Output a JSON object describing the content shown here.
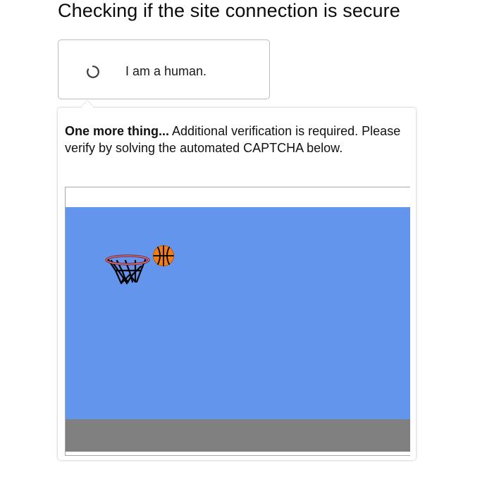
{
  "page": {
    "title": "Checking if the site connection is secure"
  },
  "human_check": {
    "label": "I am a human.",
    "spinner_icon": "loading-spinner-icon"
  },
  "verification": {
    "lead": "One more thing...",
    "message": " Additional verification is required. Please verify by solving the automated CAPTCHA below."
  },
  "captcha": {
    "icons": {
      "hoop": "basketball-hoop-icon",
      "ball": "basketball-icon"
    },
    "colors": {
      "sky": "#6495ed",
      "ground": "#808080",
      "ball": "#f07d1b",
      "rim": "#8b1a2b",
      "net": "#000000"
    }
  }
}
